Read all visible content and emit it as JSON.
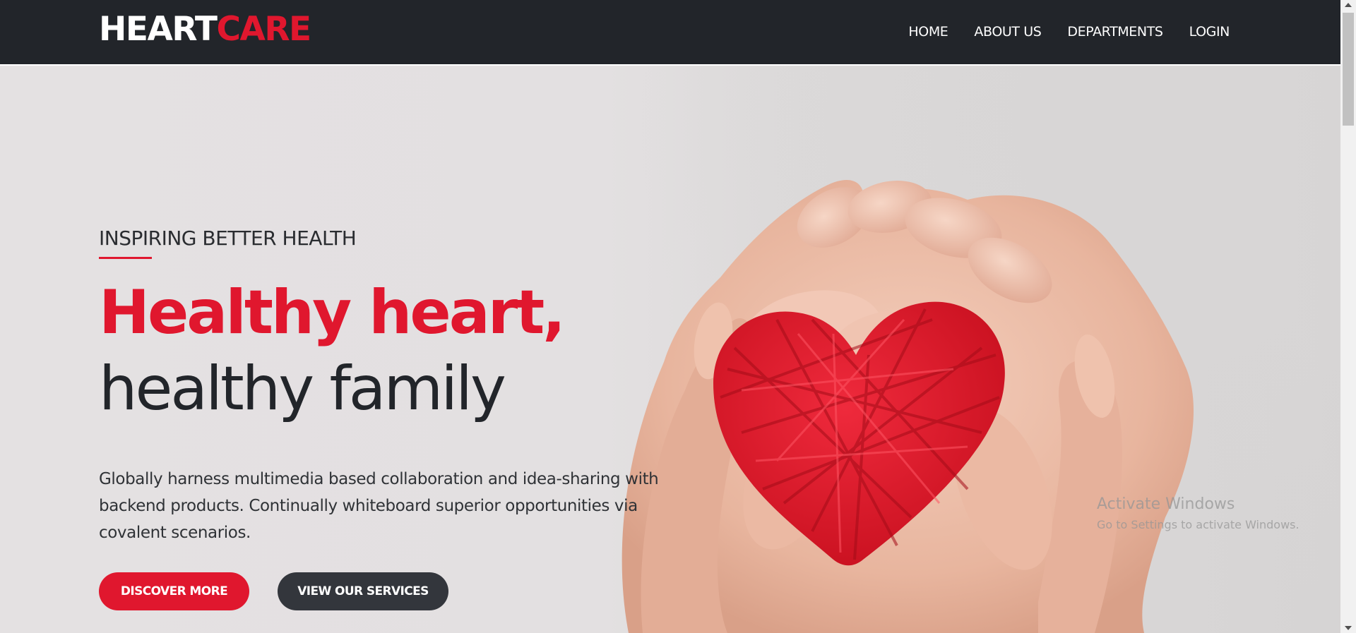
{
  "brand": {
    "logo_part1": "HEART",
    "logo_part2": "CARE",
    "accent_color": "#e0172e",
    "dark_color": "#22252a"
  },
  "nav": {
    "items": [
      "HOME",
      "ABOUT US",
      "DEPARTMENTS",
      "LOGIN"
    ]
  },
  "hero": {
    "kicker": "INSPIRING BETTER HEALTH",
    "headline_red": "Healthy heart,",
    "headline_dark": "healthy family",
    "description": "Globally harness multimedia based collaboration and idea-sharing with backend products. Continually whiteboard superior opportunities via covalent scenarios.",
    "primary_button": "DISCOVER MORE",
    "secondary_button": "VIEW OUR SERVICES",
    "image": "hands-holding-red-heart-photo"
  },
  "watermark": {
    "title": "Activate Windows",
    "subtitle": "Go to Settings to activate Windows."
  }
}
